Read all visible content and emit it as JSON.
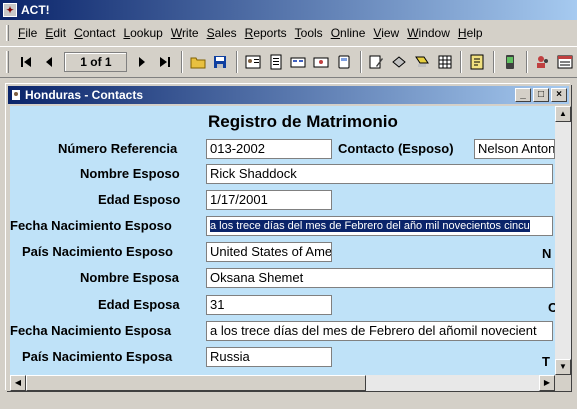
{
  "app": {
    "title": "ACT!"
  },
  "menu": {
    "items": [
      {
        "pre": "",
        "u": "F",
        "post": "ile"
      },
      {
        "pre": "",
        "u": "E",
        "post": "dit"
      },
      {
        "pre": "",
        "u": "C",
        "post": "ontact"
      },
      {
        "pre": "",
        "u": "L",
        "post": "ookup"
      },
      {
        "pre": "",
        "u": "W",
        "post": "rite"
      },
      {
        "pre": "",
        "u": "S",
        "post": "ales"
      },
      {
        "pre": "",
        "u": "R",
        "post": "eports"
      },
      {
        "pre": "",
        "u": "T",
        "post": "ools"
      },
      {
        "pre": "",
        "u": "O",
        "post": "nline"
      },
      {
        "pre": "",
        "u": "V",
        "post": "iew"
      },
      {
        "pre": "",
        "u": "W",
        "post": "indow"
      },
      {
        "pre": "",
        "u": "H",
        "post": "elp"
      }
    ]
  },
  "toolbar": {
    "record_counter": "1 of 1"
  },
  "window": {
    "title": "Honduras - Contacts"
  },
  "form": {
    "title": "Registro de Matrimonio",
    "numero_referencia_label": "Número Referencia",
    "numero_referencia_value": "013-2002",
    "contacto_esposo_label": "Contacto (Esposo)",
    "contacto_esposo_value": "Nelson Anton",
    "nombre_esposo_label": "Nombre Esposo",
    "nombre_esposo_value": "Rick Shaddock",
    "edad_esposo_label": "Edad Esposo",
    "edad_esposo_value": "1/17/2001",
    "fecha_nac_esposo_label": "Fecha Nacimiento Esposo",
    "fecha_nac_esposo_value": "a los trece días del mes de Febrero del año mil novecientos cincu",
    "pais_nac_esposo_label": "País Nacimiento Esposo",
    "pais_nac_esposo_value": "United States of Ame",
    "nombre_esposa_label": "Nombre Esposa",
    "nombre_esposa_value": "Oksana Shemet",
    "edad_esposa_label": "Edad Esposa",
    "edad_esposa_value": "31",
    "fecha_nac_esposa_label": "Fecha Nacimiento Esposa",
    "fecha_nac_esposa_value": "a los trece días del mes de Febrero del añomil novecient",
    "pais_nac_esposa_label": "País Nacimiento Esposa",
    "pais_nac_esposa_value": "Russia",
    "stray_1": "N",
    "stray_2": "C",
    "stray_3": "T"
  }
}
